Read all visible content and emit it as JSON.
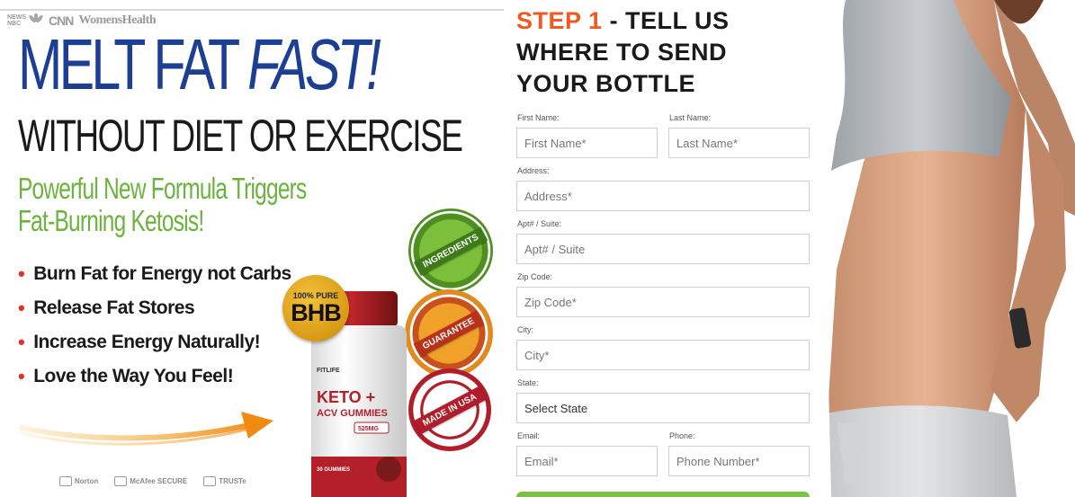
{
  "media_logos": {
    "small_1": "NEWS",
    "small_2": "NBC",
    "cnn": "CNN",
    "womens_health": "WomensHealth"
  },
  "hero": {
    "headline_plain": "MELT FAT ",
    "headline_italic": "FAST!",
    "subheadline": "WITHOUT DIET OR EXERCISE",
    "tagline_line1": "Powerful New Formula Triggers",
    "tagline_line2": "Fat-Burning Ketosis!"
  },
  "bullets": [
    "Burn Fat for Energy not Carbs",
    "Release Fat Stores",
    "Increase Energy Naturally!",
    "Love the Way You Feel!"
  ],
  "trust_badges": [
    "Norton",
    "McAfee SECURE",
    "TRUSTe"
  ],
  "product": {
    "badge_top": "100% PURE",
    "badge_main": "BHB",
    "brand": "FITLIFE",
    "name_line1": "KETO +",
    "name_line2": "ACV GUMMIES",
    "dose": "525MG",
    "count": "30 GUMMIES"
  },
  "seals": {
    "ingredients": "INGREDIENTS",
    "guarantee": "GUARANTEE",
    "made_in_usa": "MADE IN USA"
  },
  "form": {
    "step_number": "STEP 1",
    "step_line1_rest": " - TELL US",
    "step_line2": "WHERE TO SEND",
    "step_line3": "YOUR BOTTLE",
    "fields": {
      "first_name": {
        "label": "First Name:",
        "placeholder": "First Name*"
      },
      "last_name": {
        "label": "Last Name:",
        "placeholder": "Last Name*"
      },
      "address": {
        "label": "Address:",
        "placeholder": "Address*"
      },
      "apt": {
        "label": "Apt# / Suite:",
        "placeholder": "Apt# / Suite"
      },
      "zip": {
        "label": "Zip Code:",
        "placeholder": "Zip Code*"
      },
      "city": {
        "label": "City:",
        "placeholder": "City*"
      },
      "state": {
        "label": "State:",
        "value": "Select State"
      },
      "email": {
        "label": "Email:",
        "placeholder": "Email*"
      },
      "phone": {
        "label": "Phone:",
        "placeholder": "Phone Number*"
      }
    }
  },
  "colors": {
    "headline_blue": "#1c3f94",
    "tagline_green": "#6cb33e",
    "bullet_red": "#e2312a",
    "step_orange": "#f05a22",
    "submit_green": "#7cc242"
  }
}
